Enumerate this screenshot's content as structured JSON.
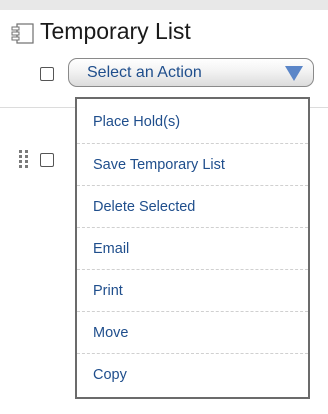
{
  "header": {
    "title": "Temporary List",
    "title_icon": "list-document-icon"
  },
  "toolbar": {
    "select_all_checked": false,
    "action_select": {
      "label": "Select an Action",
      "icon": "chevron-down-icon",
      "accent": "#5b86c8"
    }
  },
  "list_row": {
    "drag_icon": "drag-handle-icon",
    "checked": false
  },
  "dropdown": {
    "items": [
      {
        "label": "Place Hold(s)"
      },
      {
        "label": "Save Temporary List"
      },
      {
        "label": "Delete Selected"
      },
      {
        "label": "Email"
      },
      {
        "label": "Print"
      },
      {
        "label": "Move"
      },
      {
        "label": "Copy"
      }
    ]
  }
}
